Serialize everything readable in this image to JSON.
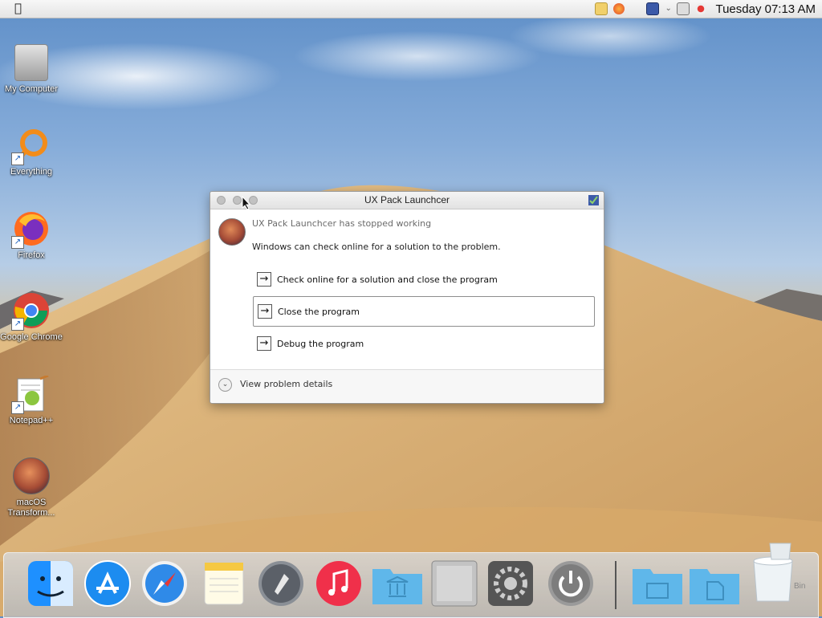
{
  "menubar": {
    "clock": "Tuesday 07:13 AM"
  },
  "desktop": {
    "icons": [
      {
        "label": "My Computer"
      },
      {
        "label": "Everything"
      },
      {
        "label": "Firefox"
      },
      {
        "label": "Google Chrome"
      },
      {
        "label": "Notepad++"
      },
      {
        "label": "macOS Transform..."
      }
    ]
  },
  "dialog": {
    "title": "UX Pack Launchcer",
    "heading": "UX Pack Launchcer has stopped working",
    "message": "Windows can check online for a solution to the problem.",
    "options": [
      "Check online for a solution and close the program",
      "Close the program",
      "Debug the program"
    ],
    "details_label": "View problem details"
  },
  "dock": {
    "apps": [
      "finder",
      "app-store",
      "safari",
      "notes",
      "launchpad",
      "music",
      "library",
      "computer",
      "system-preferences",
      "power",
      "desktop-folder",
      "documents-folder",
      "trash"
    ],
    "trash_label": "Bin"
  },
  "colors": {
    "accent_blue": "#1c8cf0",
    "dialog_bg": "#ffffff"
  }
}
